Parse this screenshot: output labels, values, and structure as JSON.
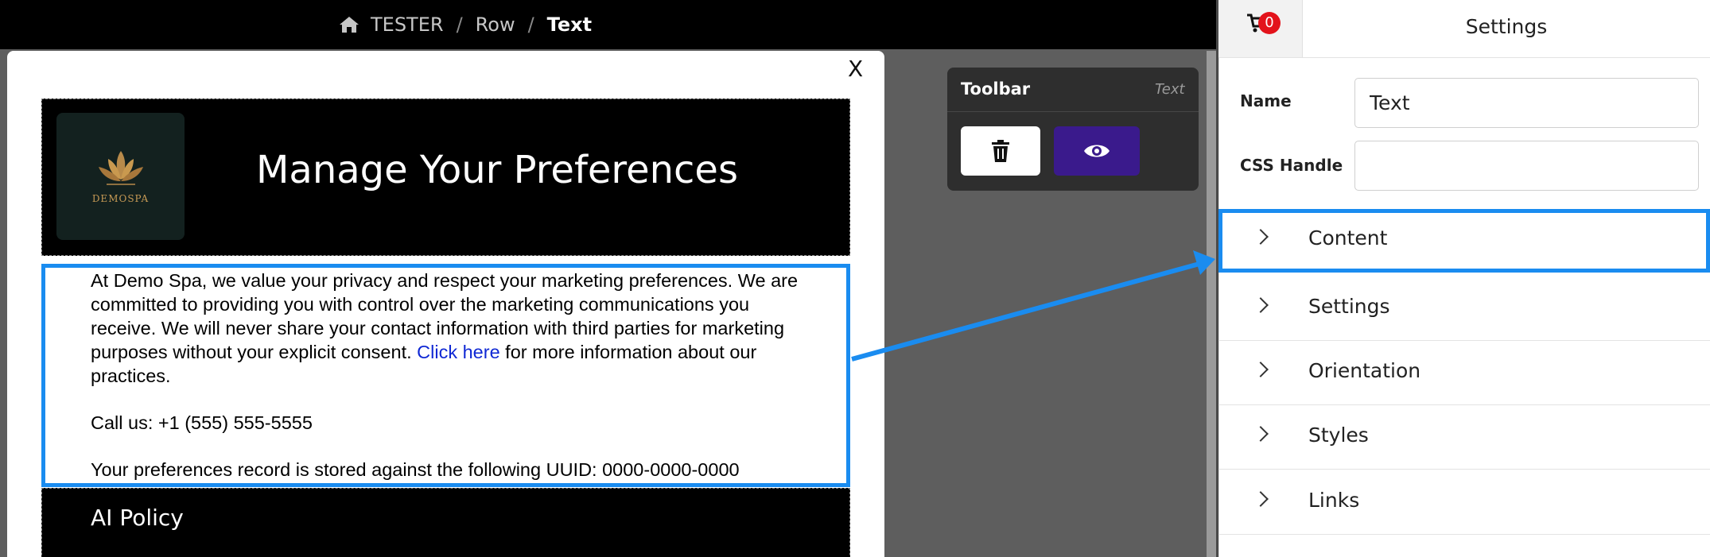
{
  "breadcrumb": {
    "items": [
      "TESTER",
      "Row",
      "Text"
    ],
    "separator": "/"
  },
  "modal": {
    "close_label": "X"
  },
  "email": {
    "logo_text": "DEMOSPA",
    "header_title": "Manage Your Preferences",
    "paragraph_before_link": "At Demo Spa, we value your privacy and respect your marketing preferences. We are committed to providing you with control over the marketing communications you receive. We will never share your contact information with third parties for marketing purposes without your explicit consent. ",
    "link_text": "Click here",
    "paragraph_after_link": " for more information about our practices.",
    "phone_line": "Call us: +1 (555) 555-5555",
    "uuid_line": "Your preferences record is stored against the following UUID: 0000-0000-0000",
    "footer_link": "AI Policy"
  },
  "toolbar": {
    "title": "Toolbar",
    "element_type": "Text",
    "delete_icon": "trash-icon",
    "preview_icon": "eye-icon"
  },
  "settings": {
    "cart_count": "0",
    "title": "Settings",
    "name_label": "Name",
    "name_value": "Text",
    "css_handle_label": "CSS Handle",
    "css_handle_value": "",
    "sections": [
      "Content",
      "Settings",
      "Orientation",
      "Styles",
      "Links"
    ]
  },
  "colors": {
    "highlight": "#1a8cf0",
    "preview_button": "#3a1a8c",
    "badge": "#e3131b",
    "link": "#0f28d4"
  }
}
